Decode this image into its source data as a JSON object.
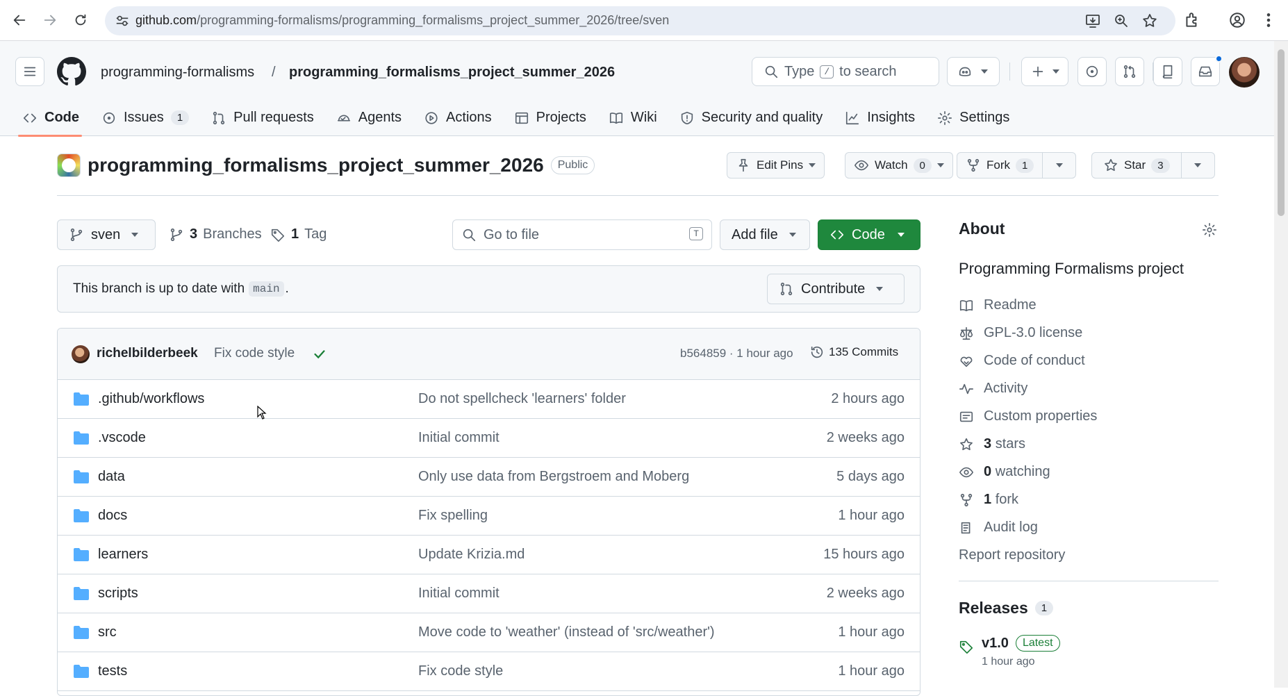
{
  "browser": {
    "url_host": "github.com",
    "url_path": "/programming-formalisms/programming_formalisms_project_summer_2026/tree/sven"
  },
  "header": {
    "owner": "programming-formalisms",
    "separator": "/",
    "repo": "programming_formalisms_project_summer_2026",
    "search_prefix": "Type",
    "search_key": "/",
    "search_suffix": "to search"
  },
  "tabs": [
    {
      "label": "Code",
      "icon": "code-icon"
    },
    {
      "label": "Issues",
      "count": "1",
      "icon": "issue-icon"
    },
    {
      "label": "Pull requests",
      "icon": "pull-request-icon"
    },
    {
      "label": "Agents",
      "icon": "agent-icon"
    },
    {
      "label": "Actions",
      "icon": "play-icon"
    },
    {
      "label": "Projects",
      "icon": "table-icon"
    },
    {
      "label": "Wiki",
      "icon": "book-icon"
    },
    {
      "label": "Security and quality",
      "icon": "shield-icon"
    },
    {
      "label": "Insights",
      "icon": "graph-icon"
    },
    {
      "label": "Settings",
      "icon": "gear-icon"
    }
  ],
  "repo": {
    "name": "programming_formalisms_project_summer_2026",
    "visibility": "Public",
    "edit_pins": "Edit Pins",
    "watch": "Watch",
    "watch_count": "0",
    "fork": "Fork",
    "fork_count": "1",
    "star": "Star",
    "star_count": "3"
  },
  "filenav": {
    "branch": "sven",
    "branches_count": "3",
    "branches_label": "Branches",
    "tags_count": "1",
    "tags_label": "Tag",
    "goto_placeholder": "Go to file",
    "goto_key": "T",
    "add_file": "Add file",
    "code": "Code"
  },
  "banner": {
    "text_before": "This branch is up to date with",
    "branch": "main",
    "text_after": ".",
    "contribute": "Contribute"
  },
  "commit": {
    "author": "richelbilderbeek",
    "message": "Fix code style",
    "sha_time": "b564859 · 1 hour ago",
    "commits": "135 Commits"
  },
  "files": [
    {
      "name": ".github/workflows",
      "message": "Do not spellcheck 'learners' folder",
      "age": "2 hours ago"
    },
    {
      "name": ".vscode",
      "message": "Initial commit",
      "age": "2 weeks ago"
    },
    {
      "name": "data",
      "message": "Only use data from Bergstroem and Moberg",
      "age": "5 days ago"
    },
    {
      "name": "docs",
      "message": "Fix spelling",
      "age": "1 hour ago"
    },
    {
      "name": "learners",
      "message": "Update Krizia.md",
      "age": "15 hours ago"
    },
    {
      "name": "scripts",
      "message": "Initial commit",
      "age": "2 weeks ago"
    },
    {
      "name": "src",
      "message": "Move code to 'weather' (instead of 'src/weather')",
      "age": "1 hour ago"
    },
    {
      "name": "tests",
      "message": "Fix code style",
      "age": "1 hour ago"
    }
  ],
  "about": {
    "title": "About",
    "description": "Programming Formalisms project",
    "readme": "Readme",
    "license": "GPL-3.0 license",
    "conduct": "Code of conduct",
    "activity": "Activity",
    "custom": "Custom properties",
    "stars_n": "3",
    "stars": "stars",
    "watching_n": "0",
    "watching": "watching",
    "fork_n": "1",
    "fork": "fork",
    "audit": "Audit log",
    "report": "Report repository"
  },
  "releases": {
    "title": "Releases",
    "count": "1",
    "tag": "v1.0",
    "latest": "Latest",
    "time": "1 hour ago"
  }
}
